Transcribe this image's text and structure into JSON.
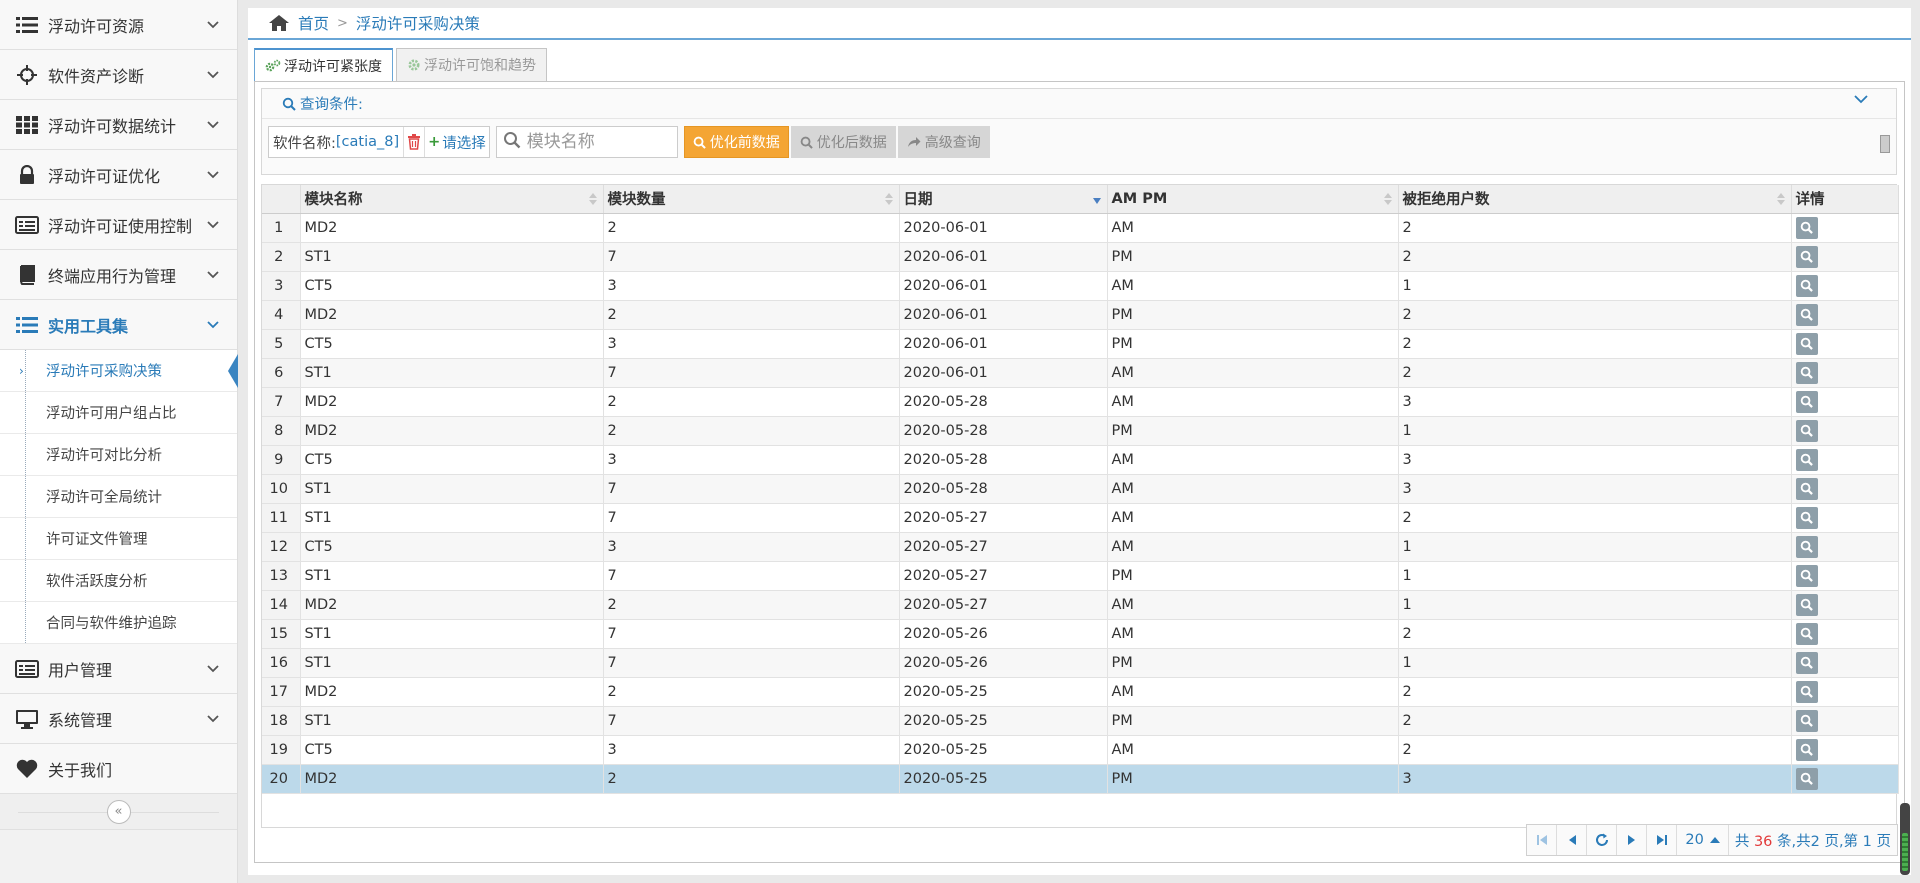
{
  "sidebar": {
    "items": [
      {
        "label": "浮动许可资源",
        "icon": "list-icon"
      },
      {
        "label": "软件资产诊断",
        "icon": "crosshair-icon"
      },
      {
        "label": "浮动许可数据统计",
        "icon": "grid-icon"
      },
      {
        "label": "浮动许可证优化",
        "icon": "lock-icon"
      },
      {
        "label": "浮动许可证使用控制",
        "icon": "card-icon"
      },
      {
        "label": "终端应用行为管理",
        "icon": "book-icon"
      },
      {
        "label": "实用工具集",
        "icon": "list-icon"
      },
      {
        "label": "用户管理",
        "icon": "card-icon"
      },
      {
        "label": "系统管理",
        "icon": "monitor-icon"
      },
      {
        "label": "关于我们",
        "icon": "heart-icon"
      }
    ],
    "submenu": [
      "浮动许可采购决策",
      "浮动许可用户组占比",
      "浮动许可对比分析",
      "浮动许可全局统计",
      "许可证文件管理",
      "软件活跃度分析",
      "合同与软件维护追踪"
    ],
    "collapse_glyph": "«"
  },
  "breadcrumb": {
    "home": "首页",
    "sep": ">",
    "current": "浮动许可采购决策"
  },
  "tabs": [
    "浮动许可紧张度",
    "浮动许可饱和趋势"
  ],
  "query": {
    "title": "查询条件:",
    "software_label": "软件名称:",
    "software_value": "[catia_8]",
    "pick_label": "请选择",
    "search_placeholder": "模块名称",
    "btn_before": "优化前数据",
    "btn_after": "优化后数据",
    "btn_advanced": "高级查询"
  },
  "table": {
    "columns": [
      "模块名称",
      "模块数量",
      "日期",
      "AM PM",
      "被拒绝用户数",
      "详情"
    ],
    "rows": [
      [
        "1",
        "MD2",
        "2",
        "2020-06-01",
        "AM",
        "2"
      ],
      [
        "2",
        "ST1",
        "7",
        "2020-06-01",
        "PM",
        "2"
      ],
      [
        "3",
        "CT5",
        "3",
        "2020-06-01",
        "AM",
        "1"
      ],
      [
        "4",
        "MD2",
        "2",
        "2020-06-01",
        "PM",
        "2"
      ],
      [
        "5",
        "CT5",
        "3",
        "2020-06-01",
        "PM",
        "2"
      ],
      [
        "6",
        "ST1",
        "7",
        "2020-06-01",
        "AM",
        "2"
      ],
      [
        "7",
        "MD2",
        "2",
        "2020-05-28",
        "AM",
        "3"
      ],
      [
        "8",
        "MD2",
        "2",
        "2020-05-28",
        "PM",
        "1"
      ],
      [
        "9",
        "CT5",
        "3",
        "2020-05-28",
        "AM",
        "3"
      ],
      [
        "10",
        "ST1",
        "7",
        "2020-05-28",
        "AM",
        "3"
      ],
      [
        "11",
        "ST1",
        "7",
        "2020-05-27",
        "AM",
        "2"
      ],
      [
        "12",
        "CT5",
        "3",
        "2020-05-27",
        "AM",
        "1"
      ],
      [
        "13",
        "ST1",
        "7",
        "2020-05-27",
        "PM",
        "1"
      ],
      [
        "14",
        "MD2",
        "2",
        "2020-05-27",
        "AM",
        "1"
      ],
      [
        "15",
        "ST1",
        "7",
        "2020-05-26",
        "AM",
        "2"
      ],
      [
        "16",
        "ST1",
        "7",
        "2020-05-26",
        "PM",
        "1"
      ],
      [
        "17",
        "MD2",
        "2",
        "2020-05-25",
        "AM",
        "2"
      ],
      [
        "18",
        "ST1",
        "7",
        "2020-05-25",
        "PM",
        "2"
      ],
      [
        "19",
        "CT5",
        "3",
        "2020-05-25",
        "AM",
        "2"
      ],
      [
        "20",
        "MD2",
        "2",
        "2020-05-25",
        "PM",
        "3"
      ]
    ],
    "selected_row": 20
  },
  "pager": {
    "page_size": "20",
    "info_prefix": "共",
    "total": "36",
    "info_suffix": "条,共2 页,第 1 页"
  },
  "colors": {
    "accent": "#2a7bb8",
    "orange": "#f4a534",
    "selected": "#bcd9ea"
  }
}
